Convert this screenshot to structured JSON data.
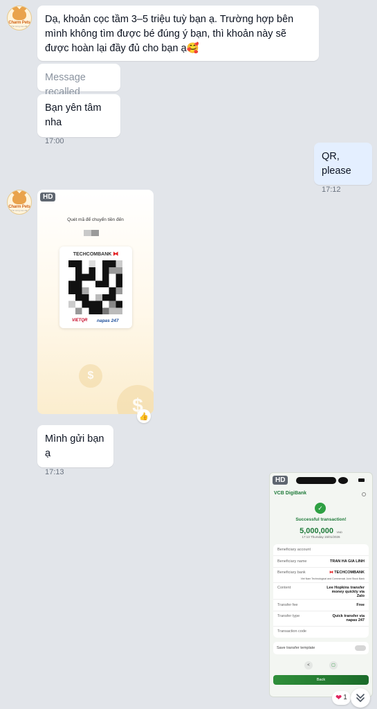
{
  "contact": {
    "avatar_brand": "Charm Pets",
    "avatar_sub": "Thú cưng cao cấp"
  },
  "messages": {
    "m1_text": "Dạ, khoản cọc tầm 3–5 triệu tuỳ bạn ạ. Trường hợp bên mình không tìm được bé đúng ý bạn, thì khoản này sẽ được hoàn lại đầy đủ cho bạn ạ🥰",
    "m2_text": "Message recalled",
    "m3_text": "Bạn yên tâm nha",
    "m3_time": "17:00",
    "m4_text": "QR, please",
    "m4_time": "17:12",
    "m6_text": "Mình gửi bạn ạ",
    "m6_time": "17:13"
  },
  "qr_image": {
    "hd_badge": "HD",
    "caption": "Quét mã để chuyển tiền đến",
    "bank_name": "TECHCOMBANK",
    "vietqr": "VIETQR",
    "napas": "napas 247",
    "reaction_icon": "thumbs-up-icon"
  },
  "receipt": {
    "hd_badge": "HD",
    "app_name": "VCB DigiBank",
    "status_title": "Successful transaction!",
    "amount": "5,000,000",
    "currency": "VND",
    "datetime": "17:13 Thursday 15/01/2026",
    "rows": [
      {
        "label": "Beneficiary account",
        "value": ""
      },
      {
        "label": "Beneficiary name",
        "value": "TRAN HA GIA LINH"
      },
      {
        "label": "Beneficiary bank",
        "value": "TECHCOMBANK"
      },
      {
        "label": "Content",
        "value": "Lee Hopkins transfer money quickly via Zalo"
      },
      {
        "label": "Transfer fee",
        "value": "Free"
      },
      {
        "label": "Transfer type",
        "value": "Quick transfer via napas 247"
      },
      {
        "label": "Transaction code",
        "value": ""
      }
    ],
    "bank_full_name": "Viet Nam Technological and Commercial Joint Stock Bank",
    "save_template": "Save transfer template",
    "back_label": "Back",
    "reaction_count": "1"
  }
}
